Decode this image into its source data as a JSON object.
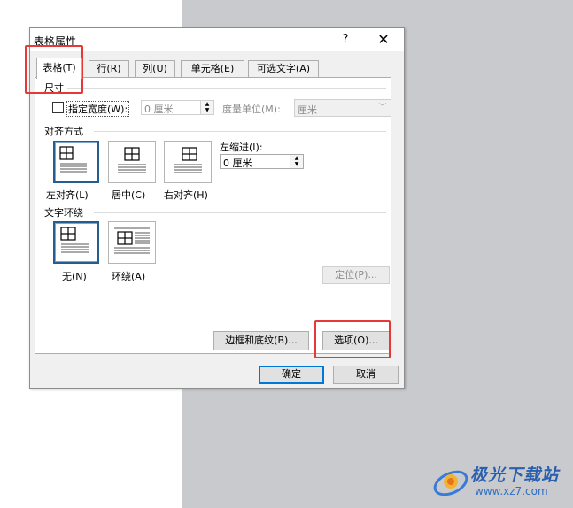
{
  "dialog": {
    "title": "表格属性",
    "help": "?",
    "close": "✕"
  },
  "tabs": [
    {
      "label": "表格(T)",
      "active": true
    },
    {
      "label": "行(R)"
    },
    {
      "label": "列(U)"
    },
    {
      "label": "单元格(E)"
    },
    {
      "label": "可选文字(A)"
    }
  ],
  "size": {
    "section": "尺寸",
    "specify_width_label": "指定宽度(W):",
    "width_value": "0 厘米",
    "unit_label": "度量单位(M):",
    "unit_value": "厘米"
  },
  "alignment": {
    "section": "对齐方式",
    "options": [
      {
        "label": "左对齐(L)",
        "selected": true
      },
      {
        "label": "居中(C)"
      },
      {
        "label": "右对齐(H)"
      }
    ],
    "indent_label": "左缩进(I):",
    "indent_value": "0 厘米"
  },
  "wrapping": {
    "section": "文字环绕",
    "options": [
      {
        "label": "无(N)",
        "selected": true
      },
      {
        "label": "环绕(A)"
      }
    ],
    "position_button": "定位(P)..."
  },
  "buttons": {
    "borders": "边框和底纹(B)...",
    "options": "选项(O)...",
    "ok": "确定",
    "cancel": "取消"
  },
  "watermark": {
    "title": "极光下载站",
    "url": "www.xz7.com"
  },
  "colors": {
    "highlight": "#e53935",
    "selection": "#245e8f",
    "primary_border": "#0078d7"
  }
}
